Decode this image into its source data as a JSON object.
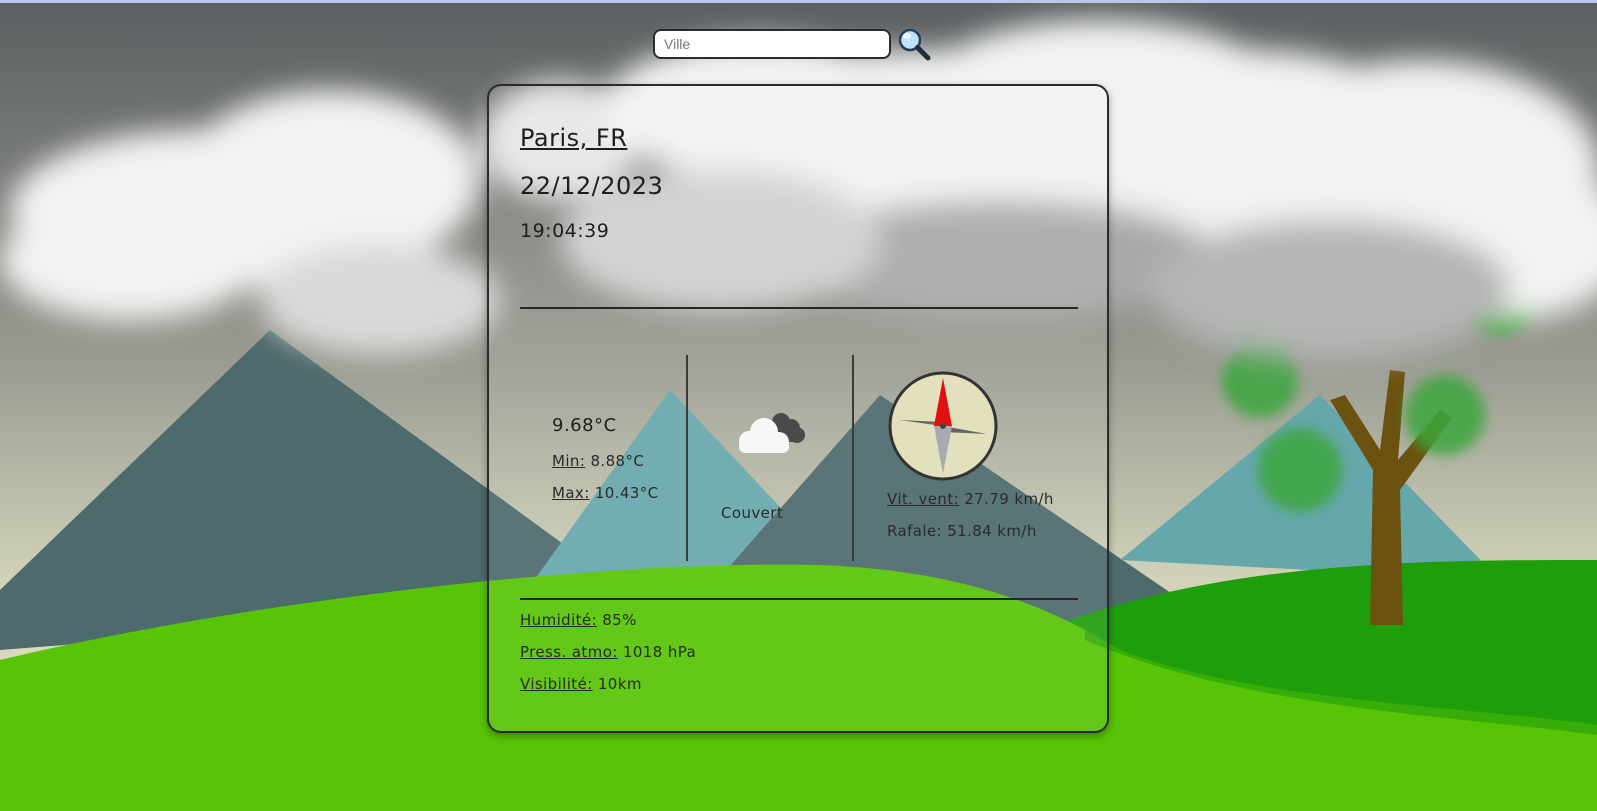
{
  "search": {
    "placeholder": "Ville"
  },
  "location": {
    "city": "Paris, FR",
    "date": "22/12/2023",
    "time": "19:04:39"
  },
  "temperature": {
    "current": "9.68°C",
    "min_label": "Min:",
    "min_value": "8.88°C",
    "max_label": "Max:",
    "max_value": "10.43°C"
  },
  "condition": {
    "icon": "cloudy-icon",
    "description": "Couvert"
  },
  "wind": {
    "speed_label": "Vit. vent:",
    "speed_value": "27.79 km/h",
    "gust_label": "Rafale:",
    "gust_value": "51.84 km/h"
  },
  "details": {
    "humidity_label": "Humidité:",
    "humidity_value": "85%",
    "pressure_label": "Press. atmo:",
    "pressure_value": "1018 hPa",
    "visibility_label": "Visibilité:",
    "visibility_value": "10km"
  },
  "colors": {
    "sky_top": "#5b5f61",
    "sky_bottom": "#d8d9bd",
    "mountain": "#4d6a6c",
    "mountain_light": "#66a7ac",
    "grass": "#57c406",
    "grass_dark": "#1f9e0c",
    "compass_face": "#e3e0bd",
    "needle_north": "#e01010",
    "needle_south": "#a9aab2"
  }
}
